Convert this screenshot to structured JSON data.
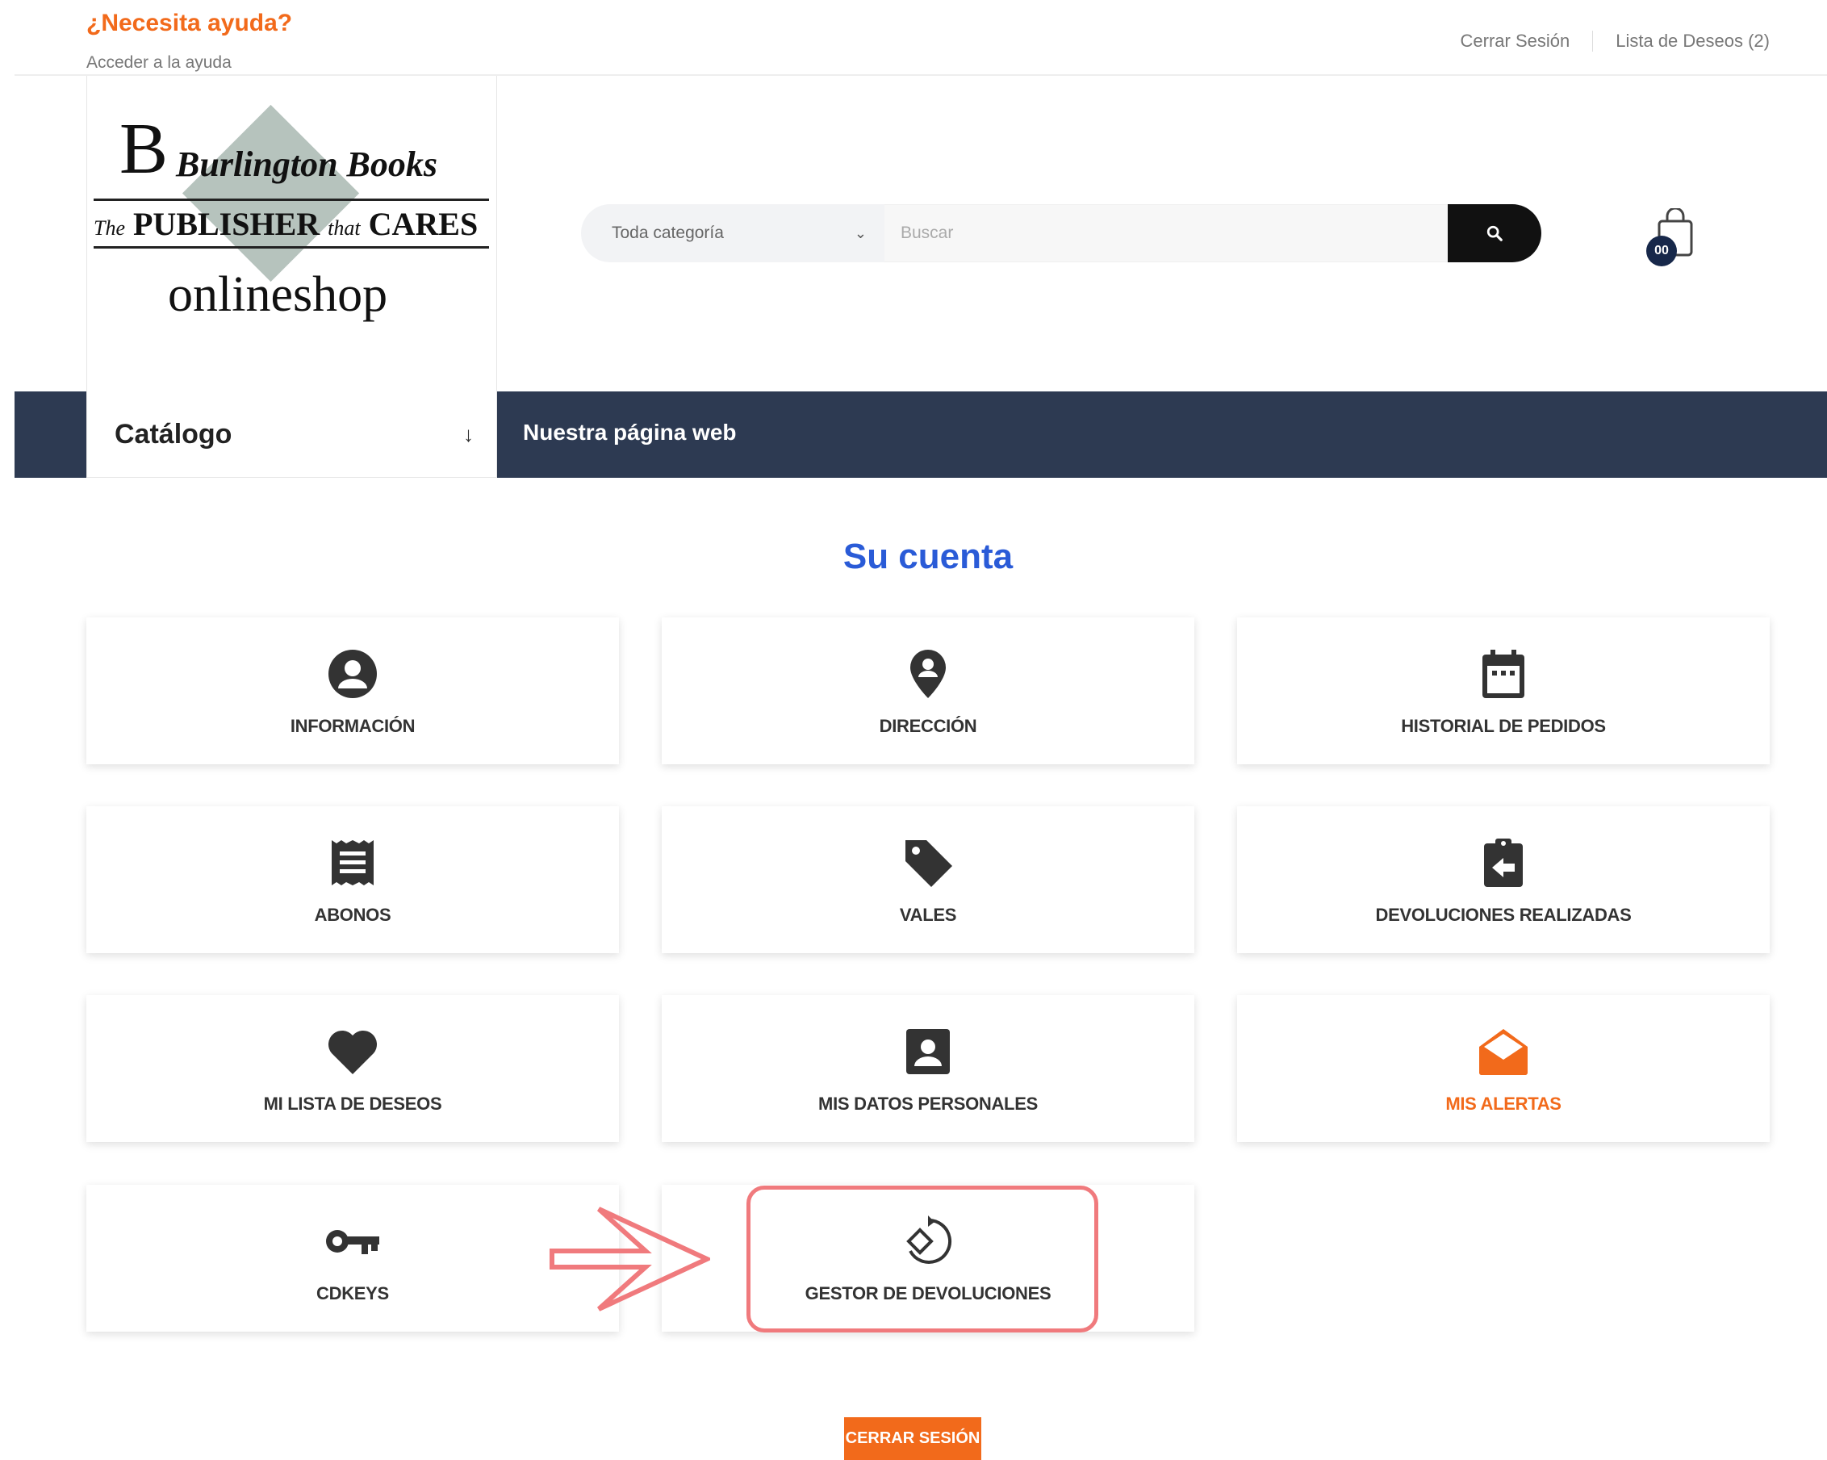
{
  "topbar": {
    "help_title": "¿Necesita ayuda?",
    "help_link": "Acceder a la ayuda",
    "logout_link": "Cerrar Sesión",
    "wishlist_link": "Lista de Deseos (2)"
  },
  "logo": {
    "initial": "B",
    "name": "Burlington Books",
    "tagline_the": "The",
    "tagline_publisher": "PUBLISHER",
    "tagline_that": "that",
    "tagline_cares": "CARES",
    "shop": "onlineshop"
  },
  "search": {
    "category": "Toda categoría",
    "placeholder": "Buscar",
    "icon": "search-icon"
  },
  "cart": {
    "count": "00",
    "icon": "shopping-bag-icon"
  },
  "nav": {
    "catalog": "Catálogo",
    "catalog_arrow": "↓",
    "website": "Nuestra página web"
  },
  "account": {
    "title": "Su cuenta",
    "cards": [
      {
        "label": "INFORMACIÓN",
        "icon": "user-circle-icon"
      },
      {
        "label": "DIRECCIÓN",
        "icon": "map-marker-icon"
      },
      {
        "label": "HISTORIAL DE PEDIDOS",
        "icon": "calendar-icon"
      },
      {
        "label": "ABONOS",
        "icon": "receipt-icon"
      },
      {
        "label": "VALES",
        "icon": "tag-icon"
      },
      {
        "label": "DEVOLUCIONES REALIZADAS",
        "icon": "clipboard-return-icon"
      },
      {
        "label": "MI LISTA DE DESEOS",
        "icon": "heart-icon"
      },
      {
        "label": "MIS DATOS PERSONALES",
        "icon": "contact-card-icon"
      },
      {
        "label": "MIS ALERTAS",
        "icon": "envelope-open-icon"
      },
      {
        "label": "CDKEYS",
        "icon": "key-icon"
      },
      {
        "label": "GESTOR DE DEVOLUCIONES",
        "icon": "rotate-diamond-icon"
      }
    ],
    "logout_button": "CERRAR SESIÓN"
  },
  "colors": {
    "accent_orange": "#f26a1b",
    "title_blue": "#2a5bd7",
    "nav_navy": "#2d3a52",
    "annotation_pink": "#f07a7d",
    "icon_dark": "#333333"
  }
}
